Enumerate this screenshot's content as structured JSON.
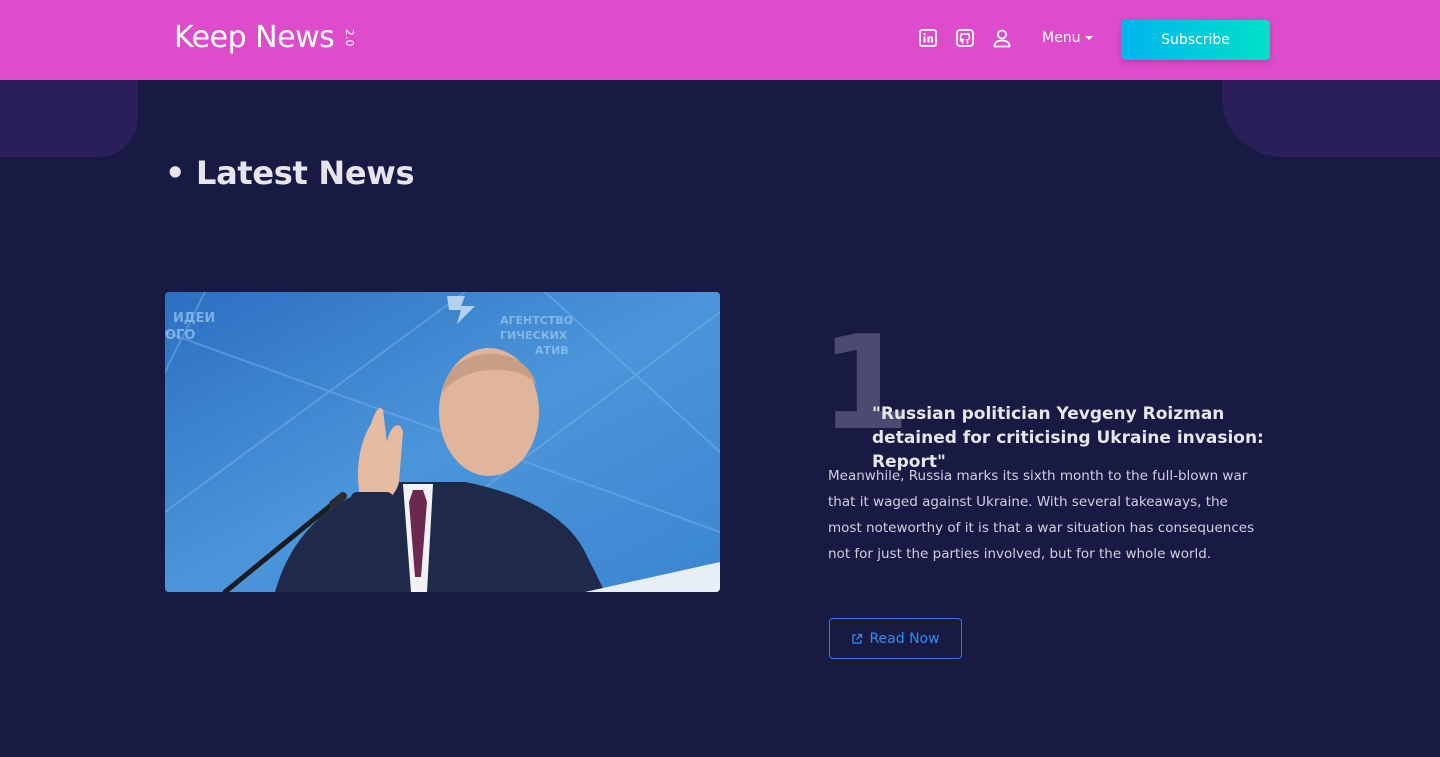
{
  "navbar": {
    "brand": "Keep News",
    "version": "2.0",
    "icons": [
      "linkedin-icon",
      "github-icon",
      "user-icon"
    ],
    "menu_label": "Menu",
    "subscribe_label": "Subscribe",
    "colors": {
      "background": "#dd4ccb",
      "subscribe_start": "#00b5ee",
      "subscribe_end": "#00e1c8"
    }
  },
  "section": {
    "title": "• Latest News"
  },
  "article": {
    "rank": "1",
    "headline": "\"Russian politician Yevgeny Roizman detained for criticising Ukraine invasion: Report\"",
    "excerpt": "Meanwhile, Russia marks its sixth month to the full-blown war that it waged against Ukraine. With several takeaways, the most noteworthy of it is that a war situation has consequences not for just the parties involved, but for the whole world.",
    "read_now_label": "Read Now",
    "read_now_icon": "external-link-icon",
    "image_backdrop_text": [
      "ИДЕИ",
      "ОГО",
      "АГЕНТСТВО",
      "ГИЧЕСКИХ",
      "АТИВ"
    ]
  },
  "theme": {
    "page_background": "#191a44",
    "corner_accent": "#2b1f5a",
    "link_color": "#2f8ff0"
  }
}
